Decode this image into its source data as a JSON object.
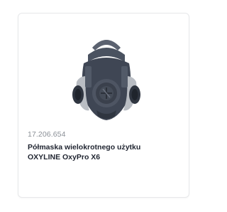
{
  "product": {
    "sku": "17.206.654",
    "name_line1": "Półmaska wielokrotnego użytku",
    "name_line2": "OXYLINE OxyPro X6",
    "image_icon": "half-mask-respirator-icon"
  }
}
